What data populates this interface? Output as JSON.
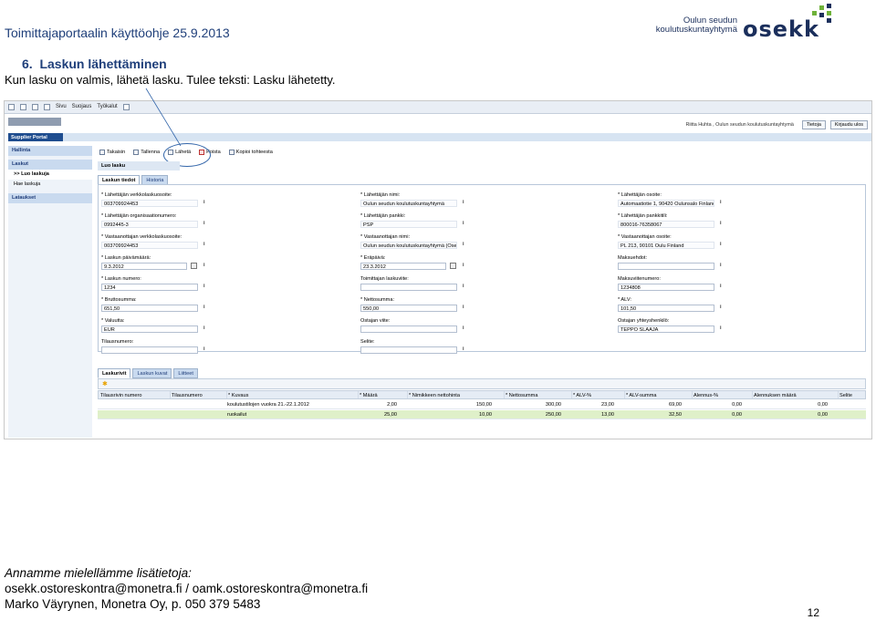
{
  "doc": {
    "title": "Toimittajaportaalin käyttöohje 25.9.2013",
    "logo_org_line1": "Oulun seudun",
    "logo_org_line2": "koulutuskuntayhtymä",
    "logo_word": "osekk",
    "logo_colors": [
      "#6fb23a",
      "#1b2f5c"
    ],
    "section_number": "6.",
    "section_title": "Laskun lähettäminen",
    "section_text": "Kun lasku on valmis, lähetä lasku. Tulee teksti: Lasku lähetetty."
  },
  "app": {
    "ie_menus": [
      "Sivu",
      "Suojaus",
      "Työkalut"
    ],
    "user_text": "Riitta Huhta , Oulun seudun koulutuskuntayhtymä",
    "top_buttons": [
      "Tietoja",
      "Kirjaudu ulos"
    ],
    "portal_title": "Supplier Portal",
    "sidebar": [
      {
        "label": "Hallinta",
        "type": "head"
      },
      {
        "label": "Laskut",
        "type": "head"
      },
      {
        "label": ">> Luo laskuja",
        "type": "active"
      },
      {
        "label": "Hae laskuja",
        "type": "item"
      },
      {
        "label": "Lataukset",
        "type": "head"
      }
    ],
    "toolbar": [
      "Takaisin",
      "Tallenna",
      "Lähetä",
      "Poista",
      "Kopioi tohteesta"
    ],
    "form_title": "Luo lasku",
    "tabs": [
      "Laskun tiedot",
      "Historia"
    ],
    "fields": [
      {
        "label": "* Lähettäjän verkkolaskuosoite:",
        "value": "003709924453",
        "col": 0,
        "row": 0,
        "ro": true
      },
      {
        "label": "* Lähettäjän nimi:",
        "value": "Oulun seudun koulutuskuntayhtymä",
        "col": 1,
        "row": 0,
        "ro": true
      },
      {
        "label": "* Lähettäjän osoite:",
        "value": "Automaatiotie 1, 90420 Oulunsalo Finland",
        "col": 2,
        "row": 0,
        "ro": true
      },
      {
        "label": "* Lähettäjän organisaationumero:",
        "value": "0992445-3",
        "col": 0,
        "row": 1,
        "ro": true
      },
      {
        "label": "* Lähettäjän pankki:",
        "value": "PSP",
        "col": 1,
        "row": 1,
        "ro": true
      },
      {
        "label": "* Lähettäjän pankkitili:",
        "value": "800016-76358067",
        "col": 2,
        "row": 1,
        "ro": true
      },
      {
        "label": "* Vastaanottajan verkkolaskuosoite:",
        "value": "003709924453",
        "col": 0,
        "row": 2,
        "ro": true
      },
      {
        "label": "* Vastaanottajan nimi:",
        "value": "Oulun seudun koulutuskuntayhtymä (Ose",
        "col": 1,
        "row": 2,
        "ro": true
      },
      {
        "label": "* Vastaanottajan osoite:",
        "value": "PL 213, 90101 Oulu Finland",
        "col": 2,
        "row": 2,
        "ro": true
      },
      {
        "label": "* Laskun päivämäärä:",
        "value": "9.3.2012",
        "col": 0,
        "row": 3,
        "cal": true
      },
      {
        "label": "* Eräpäivä:",
        "value": "23.3.2012",
        "col": 1,
        "row": 3,
        "cal": true
      },
      {
        "label": "Maksuehdot:",
        "value": "",
        "col": 2,
        "row": 3
      },
      {
        "label": "* Laskun numero:",
        "value": "1234",
        "col": 0,
        "row": 4
      },
      {
        "label": "Toimittajan laskuviite:",
        "value": "",
        "col": 1,
        "row": 4
      },
      {
        "label": "Maksuviitenumero:",
        "value": "1234808",
        "col": 2,
        "row": 4
      },
      {
        "label": "* Bruttosumma:",
        "value": "651,50",
        "col": 0,
        "row": 5
      },
      {
        "label": "* Nettosumma:",
        "value": "550,00",
        "col": 1,
        "row": 5
      },
      {
        "label": "* ALV:",
        "value": "101,50",
        "col": 2,
        "row": 5
      },
      {
        "label": "* Valuutta:",
        "value": "EUR",
        "col": 0,
        "row": 6
      },
      {
        "label": "Ostajan viite:",
        "value": "",
        "col": 1,
        "row": 6
      },
      {
        "label": "Ostajan yhteyshenkilö:",
        "value": "TEPPO SLAAJA",
        "col": 2,
        "row": 6
      },
      {
        "label": "Tilausnumero:",
        "value": "",
        "col": 0,
        "row": 7
      },
      {
        "label": "Selite:",
        "value": "",
        "col": 1,
        "row": 7
      }
    ],
    "lower_tabs": [
      "Laskurivit",
      "Laskun kuvat",
      "Liitteet"
    ],
    "grid_columns": [
      "Tilausrivin numero",
      "Tilausnumero",
      "* Kuvaus",
      "* Määrä",
      "* Nimikkeen nettohinta",
      "* Nettosumma",
      "* ALV-%",
      "* ALV-summa",
      "Alennus-%",
      "Alennuksen määrä",
      "Selite"
    ],
    "grid_rows": [
      [
        "",
        "",
        "koulutustilojen vuokra 21.-22.1.2012",
        "2,00",
        "150,00",
        "300,00",
        "23,00",
        "69,00",
        "0,00",
        "0,00",
        ""
      ],
      [
        "",
        "",
        "ruokailut",
        "25,00",
        "10,00",
        "250,00",
        "13,00",
        "32,50",
        "0,00",
        "0,00",
        ""
      ]
    ]
  },
  "footer": {
    "line1": "Annamme mielellämme lisätietoja:",
    "line2": "osekk.ostoreskontra@monetra.fi  / oamk.ostoreskontra@monetra.fi",
    "line3": "Marko Väyrynen, Monetra Oy, p. 050 379 5483",
    "page": "12"
  }
}
